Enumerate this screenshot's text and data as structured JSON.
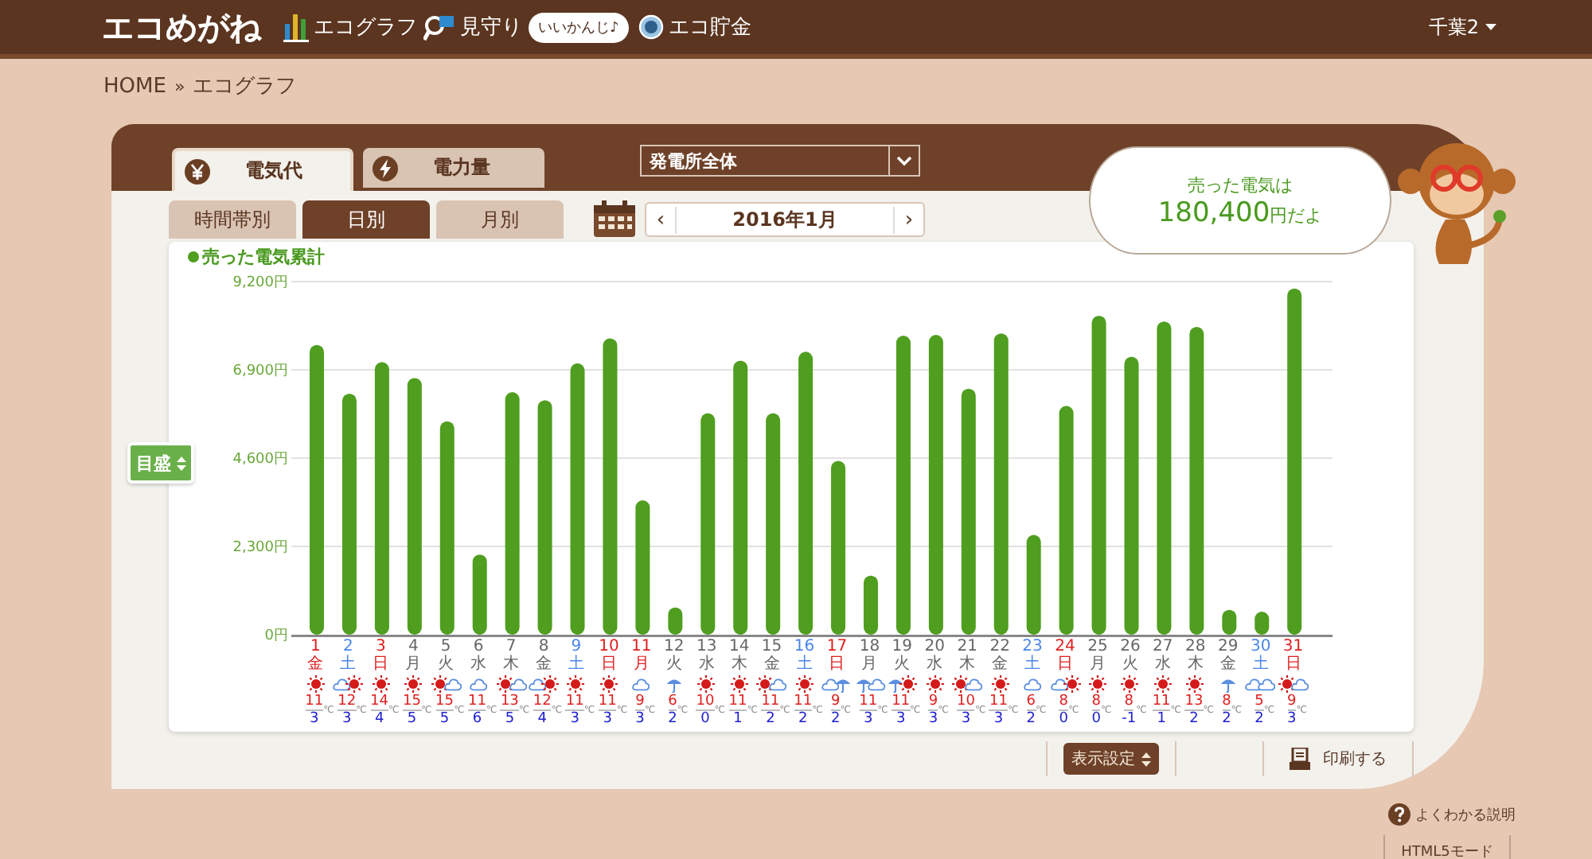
{
  "header": {
    "logo": "エコめがね",
    "nav": [
      {
        "kind": "graph",
        "label": "エコグラフ"
      },
      {
        "kind": "watch",
        "label": "見守り",
        "badge": "いいかんじ♪"
      },
      {
        "kind": "coin",
        "label": "エコ貯金"
      }
    ],
    "user": "千葉2"
  },
  "breadcrumb": {
    "home": "HOME",
    "separator": "»",
    "current": "エコグラフ"
  },
  "main_tabs": [
    {
      "kind": "yen",
      "label": "電気代",
      "selected": true
    },
    {
      "kind": "bolt",
      "label": "電力量",
      "selected": false
    }
  ],
  "plant_select": {
    "value": "発電所全体"
  },
  "period_tabs": [
    {
      "label": "時間帯別",
      "selected": false
    },
    {
      "label": "日別",
      "selected": true
    },
    {
      "label": "月別",
      "selected": false
    }
  ],
  "date_nav": {
    "prev": "‹",
    "label": "2016年1月",
    "next": "›"
  },
  "balloon": {
    "line1": "売った電気は",
    "amount": "180,400",
    "unit": "円だよ"
  },
  "scale_button": "目盛",
  "chart": {
    "chart_data": {
      "type": "bar",
      "grid": true,
      "series": [
        {
          "name": "売った電気累計",
          "color": "#4f9e1f",
          "values": [
            7550,
            6280,
            7100,
            6690,
            5560,
            2090,
            6320,
            6110,
            7070,
            7720,
            3500,
            710,
            5770,
            7140,
            5770,
            7370,
            4530,
            1540,
            7790,
            7810,
            6410,
            7850,
            2600,
            5960,
            8310,
            7240,
            8160,
            8020,
            650,
            600,
            9020
          ]
        }
      ],
      "categories": [
        "1",
        "2",
        "3",
        "4",
        "5",
        "6",
        "7",
        "8",
        "9",
        "10",
        "11",
        "12",
        "13",
        "14",
        "15",
        "16",
        "17",
        "18",
        "19",
        "20",
        "21",
        "22",
        "23",
        "24",
        "25",
        "26",
        "27",
        "28",
        "29",
        "30",
        "31"
      ],
      "ylim": [
        0,
        9200
      ],
      "yticks": [
        {
          "value": 0,
          "label": "0円"
        },
        {
          "value": 2300,
          "label": "2,300円"
        },
        {
          "value": 4600,
          "label": "4,600円"
        },
        {
          "value": 6900,
          "label": "6,900円"
        },
        {
          "value": 9200,
          "label": "9,200円"
        }
      ]
    },
    "days": [
      {
        "weekday": "金",
        "kind": "holiday",
        "weather": [
          {
            "kind": "sun"
          }
        ],
        "high": "11",
        "low": "3",
        "unit": "℃"
      },
      {
        "weekday": "土",
        "kind": "saturday",
        "weather": [
          {
            "kind": "cloud"
          },
          {
            "kind": "sun"
          }
        ],
        "high": "12",
        "low": "3",
        "unit": "℃"
      },
      {
        "weekday": "日",
        "kind": "holiday",
        "weather": [
          {
            "kind": "sun"
          }
        ],
        "high": "14",
        "low": "4",
        "unit": "℃"
      },
      {
        "weekday": "月",
        "kind": "weekday",
        "weather": [
          {
            "kind": "sun"
          }
        ],
        "high": "15",
        "low": "5",
        "unit": "℃"
      },
      {
        "weekday": "火",
        "kind": "weekday",
        "weather": [
          {
            "kind": "sun"
          },
          {
            "kind": "cloud"
          }
        ],
        "high": "15",
        "low": "5",
        "unit": "℃"
      },
      {
        "weekday": "水",
        "kind": "weekday",
        "weather": [
          {
            "kind": "cloud"
          }
        ],
        "high": "11",
        "low": "6",
        "unit": "℃"
      },
      {
        "weekday": "木",
        "kind": "weekday",
        "weather": [
          {
            "kind": "sun"
          },
          {
            "kind": "cloud"
          }
        ],
        "high": "13",
        "low": "5",
        "unit": "℃"
      },
      {
        "weekday": "金",
        "kind": "weekday",
        "weather": [
          {
            "kind": "cloud"
          },
          {
            "kind": "sun"
          }
        ],
        "high": "12",
        "low": "4",
        "unit": "℃"
      },
      {
        "weekday": "土",
        "kind": "saturday",
        "weather": [
          {
            "kind": "sun"
          }
        ],
        "high": "11",
        "low": "3",
        "unit": "℃"
      },
      {
        "weekday": "日",
        "kind": "holiday",
        "weather": [
          {
            "kind": "sun"
          }
        ],
        "high": "11",
        "low": "3",
        "unit": "℃"
      },
      {
        "weekday": "月",
        "kind": "holiday",
        "weather": [
          {
            "kind": "cloud"
          }
        ],
        "high": "9",
        "low": "3",
        "unit": "℃"
      },
      {
        "weekday": "火",
        "kind": "weekday",
        "weather": [
          {
            "kind": "rain"
          }
        ],
        "high": "6",
        "low": "2",
        "unit": "℃"
      },
      {
        "weekday": "水",
        "kind": "weekday",
        "weather": [
          {
            "kind": "sun"
          }
        ],
        "high": "10",
        "low": "0",
        "unit": "℃"
      },
      {
        "weekday": "木",
        "kind": "weekday",
        "weather": [
          {
            "kind": "sun"
          }
        ],
        "high": "11",
        "low": "1",
        "unit": "℃"
      },
      {
        "weekday": "金",
        "kind": "weekday",
        "weather": [
          {
            "kind": "sun"
          },
          {
            "kind": "cloud"
          }
        ],
        "high": "11",
        "low": "2",
        "unit": "℃"
      },
      {
        "weekday": "土",
        "kind": "saturday",
        "weather": [
          {
            "kind": "sun"
          }
        ],
        "high": "11",
        "low": "2",
        "unit": "℃"
      },
      {
        "weekday": "日",
        "kind": "holiday",
        "weather": [
          {
            "kind": "cloud"
          },
          {
            "kind": "rain"
          }
        ],
        "high": "9",
        "low": "2",
        "unit": "℃"
      },
      {
        "weekday": "月",
        "kind": "weekday",
        "weather": [
          {
            "kind": "rain"
          },
          {
            "kind": "cloud"
          }
        ],
        "high": "11",
        "low": "3",
        "unit": "℃"
      },
      {
        "weekday": "火",
        "kind": "weekday",
        "weather": [
          {
            "kind": "rain"
          },
          {
            "kind": "sun"
          }
        ],
        "high": "11",
        "low": "3",
        "unit": "℃"
      },
      {
        "weekday": "水",
        "kind": "weekday",
        "weather": [
          {
            "kind": "sun"
          }
        ],
        "high": "9",
        "low": "3",
        "unit": "℃"
      },
      {
        "weekday": "木",
        "kind": "weekday",
        "weather": [
          {
            "kind": "sun"
          },
          {
            "kind": "cloud"
          }
        ],
        "high": "10",
        "low": "3",
        "unit": "℃"
      },
      {
        "weekday": "金",
        "kind": "weekday",
        "weather": [
          {
            "kind": "sun"
          }
        ],
        "high": "11",
        "low": "3",
        "unit": "℃"
      },
      {
        "weekday": "土",
        "kind": "saturday",
        "weather": [
          {
            "kind": "cloud"
          }
        ],
        "high": "6",
        "low": "2",
        "unit": "℃"
      },
      {
        "weekday": "日",
        "kind": "holiday",
        "weather": [
          {
            "kind": "cloud"
          },
          {
            "kind": "sun"
          }
        ],
        "high": "8",
        "low": "0",
        "unit": "℃"
      },
      {
        "weekday": "月",
        "kind": "weekday",
        "weather": [
          {
            "kind": "sun"
          }
        ],
        "high": "8",
        "low": "0",
        "unit": "℃"
      },
      {
        "weekday": "火",
        "kind": "weekday",
        "weather": [
          {
            "kind": "sun"
          }
        ],
        "high": "8",
        "low": "-1",
        "unit": "℃"
      },
      {
        "weekday": "水",
        "kind": "weekday",
        "weather": [
          {
            "kind": "sun"
          }
        ],
        "high": "11",
        "low": "1",
        "unit": "℃"
      },
      {
        "weekday": "木",
        "kind": "weekday",
        "weather": [
          {
            "kind": "sun"
          }
        ],
        "high": "13",
        "low": "2",
        "unit": "℃"
      },
      {
        "weekday": "金",
        "kind": "weekday",
        "weather": [
          {
            "kind": "rain"
          }
        ],
        "high": "8",
        "low": "2",
        "unit": "℃"
      },
      {
        "weekday": "土",
        "kind": "saturday",
        "weather": [
          {
            "kind": "cloud"
          },
          {
            "kind": "cloud"
          }
        ],
        "high": "5",
        "low": "2",
        "unit": "℃"
      },
      {
        "weekday": "日",
        "kind": "holiday",
        "weather": [
          {
            "kind": "sun"
          },
          {
            "kind": "cloud"
          }
        ],
        "high": "9",
        "low": "3",
        "unit": "℃"
      }
    ]
  },
  "footer": {
    "display_settings": "表示設定",
    "print": "印刷する",
    "help": "よくわかる説明",
    "html5_mode": "HTML5モード"
  }
}
